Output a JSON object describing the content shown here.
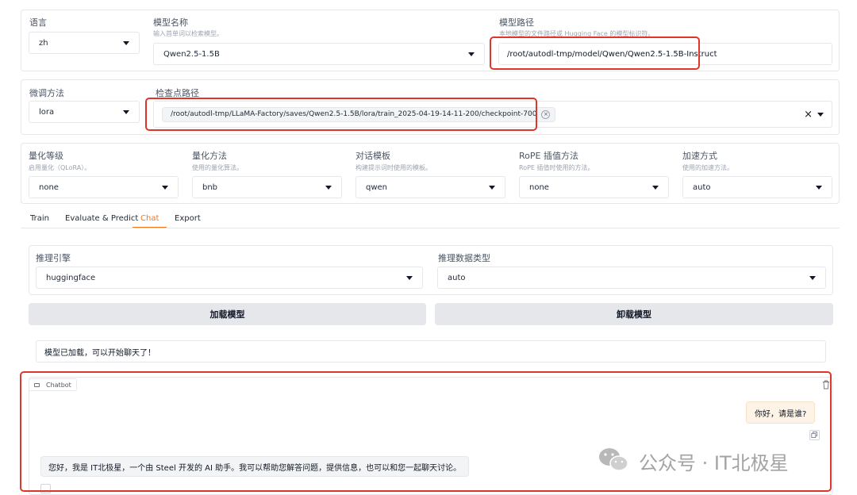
{
  "top_config": {
    "language": {
      "label": "语言",
      "value": "zh"
    },
    "model_name": {
      "label": "模型名称",
      "hint": "输入首单词以检索模型。",
      "value": "Qwen2.5-1.5B"
    },
    "model_path": {
      "label": "模型路径",
      "hint": "本地模型的文件路径或 Hugging Face 的模型标识符。",
      "value": "/root/autodl-tmp/model/Qwen/Qwen2.5-1.5B-Instruct"
    }
  },
  "finetune": {
    "method": {
      "label": "微调方法",
      "value": "lora"
    },
    "checkpoint": {
      "label": "检查点路径",
      "value": "/root/autodl-tmp/LLaMA-Factory/saves/Qwen2.5-1.5B/lora/train_2025-04-19-14-11-200/checkpoint-700",
      "remove_glyph": "×",
      "clear_glyph": "×"
    }
  },
  "advanced": [
    {
      "label": "量化等级",
      "hint": "启用量化（QLoRA）。",
      "value": "none"
    },
    {
      "label": "量化方法",
      "hint": "使用的量化算法。",
      "value": "bnb"
    },
    {
      "label": "对话模板",
      "hint": "构建提示词时使用的模板。",
      "value": "qwen"
    },
    {
      "label": "RoPE 插值方法",
      "hint": "RoPE 插值时使用的方法。",
      "value": "none"
    },
    {
      "label": "加速方式",
      "hint": "使用的加速方法。",
      "value": "auto"
    }
  ],
  "tabs": [
    "Train",
    "Evaluate & Predict",
    "Chat",
    "Export"
  ],
  "active_tab": "Chat",
  "chat_tab": {
    "engine": {
      "label": "推理引擎",
      "value": "huggingface"
    },
    "dtype": {
      "label": "推理数据类型",
      "value": "auto"
    },
    "load_button": "加载模型",
    "unload_button": "卸载模型",
    "status": "模型已加载，可以开始聊天了！",
    "chatbot_label": "Chatbot",
    "messages": [
      {
        "role": "user",
        "text": "你好，请是谁?"
      },
      {
        "role": "assistant",
        "text": "您好，我是 IT北极星，一个由 Steel 开发的 AI 助手。我可以帮助您解答问题，提供信息，也可以和您一起聊天讨论。"
      }
    ]
  },
  "watermark": "公众号 · IT北极星",
  "colors": {
    "accent": "#f97316",
    "highlight_box": "#e0352b",
    "button_bg": "#e5e7eb",
    "user_bubble": "#fdf3e6"
  }
}
